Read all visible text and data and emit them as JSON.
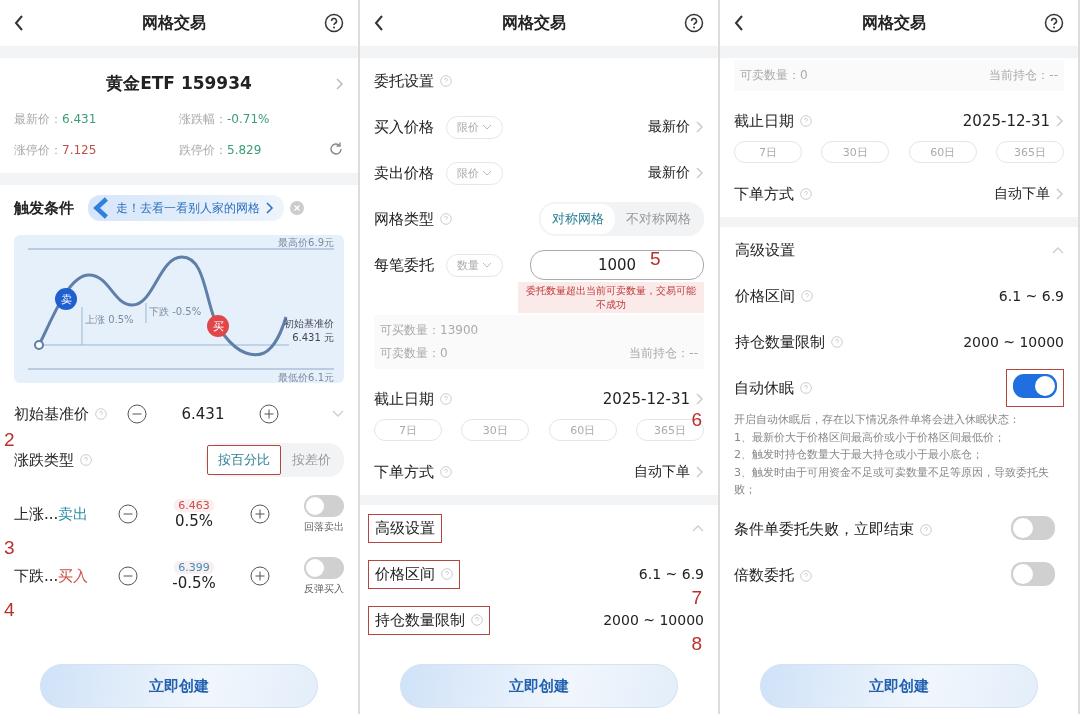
{
  "panels": [
    {
      "title": "网格交易",
      "button": "立即创建",
      "rows": [
        {
          "kind": "stock",
          "name": "黄金ETF 159934",
          "quotes": [
            {
              "label": "最新价：",
              "value": "6.431",
              "color": "#3a9d74"
            },
            {
              "label": "涨跌幅：",
              "value": "-0.71%",
              "color": "#3a9d74"
            },
            {
              "label": "涨停价：",
              "value": "7.125",
              "color": "#c0504d"
            },
            {
              "label": "跌停价：",
              "value": "5.829",
              "color": "#3a9d74"
            }
          ]
        },
        {
          "kind": "trigger",
          "label": "触发条件",
          "banner": "走！去看一看别人家的网格"
        },
        {
          "kind": "illustration",
          "top_label": "最高价6.9元",
          "bottom_label": "最低价6.1元",
          "sell": "卖",
          "buy": "买",
          "rise": "上涨 0.5%",
          "fall": "下跌 -0.5%",
          "base_label": "初始基准价",
          "base_value": "6.431 元"
        },
        {
          "kind": "stepper",
          "label": "初始基准价",
          "help": true,
          "value": "6.431",
          "note": "2"
        },
        {
          "kind": "segment",
          "label": "涨跌类型",
          "help": true,
          "options": [
            {
              "label": "按百分比",
              "selected": true,
              "highlighted": true
            },
            {
              "label": "按差价",
              "selected": false,
              "highlighted": false
            }
          ]
        },
        {
          "kind": "grid-step",
          "label": "上涨...",
          "action": {
            "text": "卖出",
            "color": "#2b8fa3"
          },
          "hint": {
            "text": "6.463",
            "color": "#c9504a"
          },
          "value": "0.5%",
          "toggle": {
            "on": false,
            "label": "回落卖出"
          },
          "note": "3"
        },
        {
          "kind": "grid-step",
          "label": "下跌...",
          "action": {
            "text": "买入",
            "color": "#c9504a"
          },
          "hint": {
            "text": "6.399",
            "color": "#3a8fc0"
          },
          "value": "-0.5%",
          "toggle": {
            "on": false,
            "label": "反弹买入"
          },
          "note": "4"
        }
      ]
    },
    {
      "title": "网格交易",
      "button": "立即创建",
      "rows": [
        {
          "kind": "heading",
          "label": "委托设置",
          "help": true
        },
        {
          "kind": "select",
          "label": "买入价格",
          "dropdown": "限价",
          "value": "最新价"
        },
        {
          "kind": "select",
          "label": "卖出价格",
          "dropdown": "限价",
          "value": "最新价"
        },
        {
          "kind": "segment",
          "label": "网格类型",
          "help": true,
          "options": [
            {
              "label": "对称网格",
              "selected": true,
              "highlighted": false
            },
            {
              "label": "不对称网格",
              "selected": false,
              "highlighted": false
            }
          ]
        },
        {
          "kind": "amount",
          "label": "每笔委托",
          "dropdown": "数量",
          "value": "1000",
          "note": "5",
          "error": "委托数量超出当前可卖数量，交易可能不成功"
        },
        {
          "kind": "info",
          "items": [
            {
              "left": "可买数量：13900"
            },
            {
              "left": "可卖数量：0",
              "right": "当前持仓：--"
            }
          ]
        },
        {
          "kind": "date",
          "label": "截止日期",
          "help": true,
          "value": "2025-12-31",
          "note": "6",
          "chips": [
            "7日",
            "30日",
            "60日",
            "365日"
          ]
        },
        {
          "kind": "link",
          "label": "下单方式",
          "help": true,
          "value": "自动下单"
        },
        {
          "kind": "section",
          "label": "高级设置",
          "highlighted": true,
          "expanded": true
        },
        {
          "kind": "range",
          "label": "价格区间",
          "help": true,
          "value": "6.1 ~ 6.9",
          "highlighted": true,
          "note": "7"
        },
        {
          "kind": "range",
          "label": "持仓数量限制",
          "help": true,
          "value": "2000 ~ 10000",
          "highlighted": true,
          "note": "8"
        }
      ]
    },
    {
      "title": "网格交易",
      "button": "立即创建",
      "rows": [
        {
          "kind": "info",
          "items": [
            {
              "left": "可卖数量：0",
              "right": "当前持仓：--"
            }
          ]
        },
        {
          "kind": "date",
          "label": "截止日期",
          "help": true,
          "value": "2025-12-31",
          "chips": [
            "7日",
            "30日",
            "60日",
            "365日"
          ]
        },
        {
          "kind": "link",
          "label": "下单方式",
          "help": true,
          "value": "自动下单"
        },
        {
          "kind": "section",
          "label": "高级设置",
          "highlighted": false,
          "expanded": true
        },
        {
          "kind": "range",
          "label": "价格区间",
          "help": true,
          "value": "6.1 ~ 6.9",
          "highlighted": false
        },
        {
          "kind": "range",
          "label": "持仓数量限制",
          "help": true,
          "value": "2000 ~ 10000",
          "highlighted": false
        },
        {
          "kind": "toggle",
          "label": "自动休眠",
          "help": true,
          "on": true,
          "highlighted": true
        },
        {
          "kind": "paragraph",
          "text": "开启自动休眠后，存在以下情况条件单将会进入休眠状态：\n1、最新价大于价格区间最高价或小于价格区间最低价；\n2、触发时持仓数量大于最大持仓或小于最小底仓；\n3、触发时由于可用资金不足或可卖数量不足等原因，导致委托失败；"
        },
        {
          "kind": "toggle",
          "label": "条件单委托失败，立即结束",
          "help": true,
          "on": false,
          "highlighted": false
        },
        {
          "kind": "toggle",
          "label": "倍数委托",
          "help": true,
          "on": false,
          "highlighted": false
        }
      ]
    }
  ]
}
